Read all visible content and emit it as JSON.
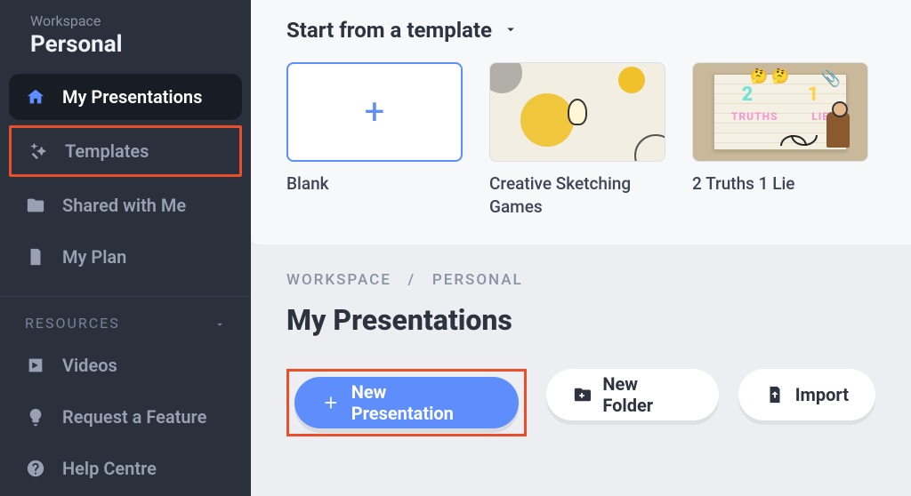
{
  "sidebar": {
    "workspace_label": "Workspace",
    "workspace_name": "Personal",
    "items": [
      {
        "label": "My Presentations"
      },
      {
        "label": "Templates"
      },
      {
        "label": "Shared with Me"
      },
      {
        "label": "My Plan"
      }
    ],
    "resources_label": "RESOURCES",
    "resources": [
      {
        "label": "Videos"
      },
      {
        "label": "Request a Feature"
      },
      {
        "label": "Help Centre"
      }
    ]
  },
  "template_strip": {
    "heading": "Start from a template",
    "cards": [
      {
        "label": "Blank"
      },
      {
        "label": "Creative Sketching Games"
      },
      {
        "label": "2 Truths 1 Lie"
      }
    ],
    "truths_card": {
      "num1": "2",
      "num2": "1",
      "word1": "TRUTHS",
      "word2": "LIE"
    }
  },
  "breadcrumb": {
    "part1": "WORKSPACE",
    "sep": "/",
    "part2": "PERSONAL"
  },
  "page_title": "My Presentations",
  "actions": {
    "new_presentation": "New Presentation",
    "new_folder": "New Folder",
    "import": "Import"
  }
}
